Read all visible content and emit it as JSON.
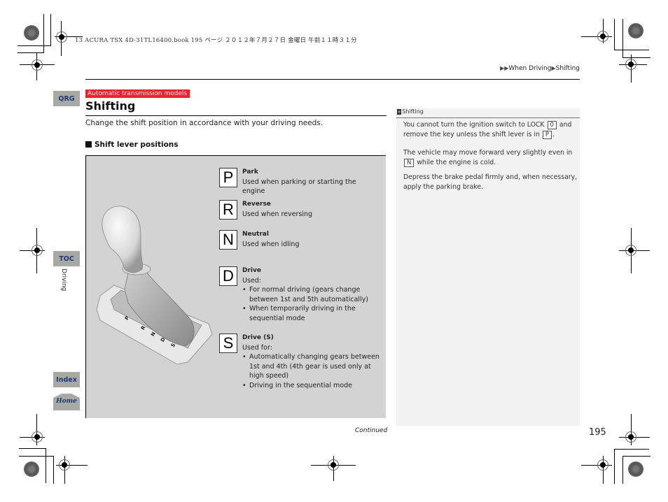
{
  "print_header": "13 ACURA TSX 4D-31TL16400.book  195 ページ  ２０１２年７月２７日  金曜日  午前１１時３１分",
  "breadcrumb": {
    "items": [
      "When Driving",
      "Shifting"
    ]
  },
  "nav_tabs": {
    "qrg": "QRG",
    "toc": "TOC",
    "section": "Driving",
    "index": "Index",
    "home": "Home"
  },
  "badge": "Automatic transmission models",
  "title": "Shifting",
  "intro": "Change the shift position in accordance with your driving needs.",
  "subheading": "Shift lever positions",
  "figure": {
    "gate_labels": [
      "P",
      "R",
      "N",
      "D",
      "S"
    ],
    "positions": [
      {
        "letter": "P",
        "name": "Park",
        "desc": "Used when parking or starting the engine",
        "bullets": []
      },
      {
        "letter": "R",
        "name": "Reverse",
        "desc": "Used when reversing",
        "bullets": []
      },
      {
        "letter": "N",
        "name": "Neutral",
        "desc": "Used when idling",
        "bullets": []
      },
      {
        "letter": "D",
        "name": "Drive",
        "desc": "Used:",
        "bullets": [
          "For normal driving (gears change between 1st and 5th automatically)",
          "When temporarily driving in the sequential mode"
        ]
      },
      {
        "letter": "S",
        "name": "Drive (S)",
        "desc": "Used for:",
        "bullets": [
          "Automatically changing gears between 1st and 4th (4th gear is used only at high speed)",
          "Driving in the sequential mode"
        ]
      }
    ]
  },
  "sidebar": {
    "heading": "Shifting",
    "p1_a": "You cannot turn the ignition switch to LOCK",
    "p1_key1": "0",
    "p1_b": "and remove the key unless the shift lever is in",
    "p1_key2": "P",
    "p1_c": ".",
    "p2_key": "N",
    "p2_a": "The vehicle may move forward very slightly even in",
    "p2_b": "while the engine is cold.",
    "p3": "Depress the brake pedal firmly and, when necessary, apply the parking brake."
  },
  "footer": {
    "continued": "Continued",
    "page_number": "195"
  },
  "colors": {
    "badge_bg": "#e8232c",
    "tab_bg": "#a8a8a4",
    "tab_text": "#1a3a78",
    "figure_bg": "#d3d3d3",
    "sidebar_bg": "#f2f2f2"
  }
}
